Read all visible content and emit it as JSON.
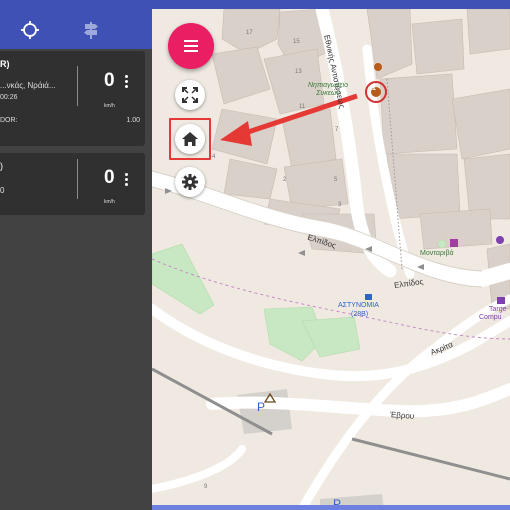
{
  "panel": {
    "tabs": [
      {
        "icon": "crosshair-icon"
      },
      {
        "icon": "signpost-icon"
      }
    ],
    "cards": [
      {
        "title": "R)",
        "subtitle": "...νκάς, Νράιά...",
        "time": "00:26",
        "row_label": "DOR:",
        "row_value": "1.00",
        "speed": "0",
        "unit": "km/h"
      },
      {
        "title": ")",
        "subtitle": "0",
        "speed": "0",
        "unit": "km/h"
      }
    ]
  },
  "map": {
    "controls": {
      "menu_icon": "menu-icon",
      "fullscreen_icon": "fullscreen-icon",
      "home_icon": "home-icon",
      "settings_icon": "gear-icon"
    },
    "labels": {
      "street_ethnikis": "Εθνικής Αντιστάσεως",
      "street_elpidos_1": "Ελπίδος",
      "street_elpidos_2": "Ελπίδος",
      "street_akritas": "Ακρίτα",
      "street_evrou": "Έβρου",
      "poi_nipiagogeio": "Νηπιαγωγείο Συκεών",
      "poi_astynomia": "ΑΣΤΥΝΟΜΙΑ",
      "poi_astynomia_ref": "(28B)",
      "poi_montariva": "Μονταριβά",
      "poi_target": "Targe",
      "poi_computers": "Compu",
      "parking_1": "P",
      "parking_2": "P",
      "num_17": "17",
      "num_15": "15",
      "num_13": "13",
      "num_11": "11",
      "num_7": "7",
      "num_5": "5",
      "num_3": "3",
      "num_4": "4",
      "num_2": "2",
      "num_1": "1",
      "num_9": "9"
    }
  },
  "colors": {
    "primary": "#3f51b5",
    "fab": "#e91e63",
    "highlight": "#e53935",
    "panel_bg": "#424242",
    "card_bg": "#303030"
  }
}
